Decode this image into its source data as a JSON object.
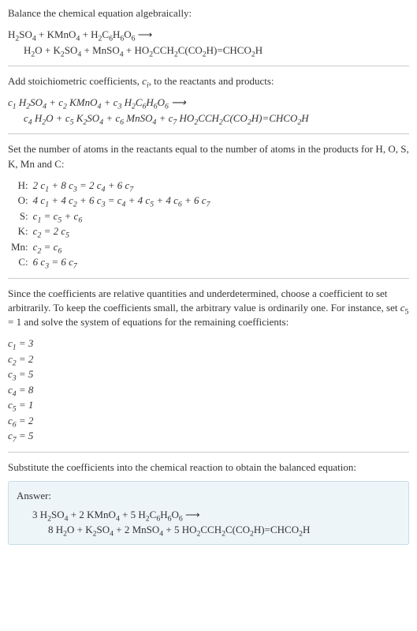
{
  "intro": "Balance the chemical equation algebraically:",
  "eq1_line1": "H₂SO₄ + KMnO₄ + H₂C₆H₆O₆ ⟶",
  "eq1_line2": "H₂O + K₂SO₄ + MnSO₄ + HO₂CCH₂C(CO₂H)=CHCO₂H",
  "stoich_intro": "Add stoichiometric coefficients, cᵢ, to the reactants and products:",
  "eq2_line1": "c₁ H₂SO₄ + c₂ KMnO₄ + c₃ H₂C₆H₆O₆ ⟶",
  "eq2_line2": "c₄ H₂O + c₅ K₂SO₄ + c₆ MnSO₄ + c₇ HO₂CCH₂C(CO₂H)=CHCO₂H",
  "set_intro": "Set the number of atoms in the reactants equal to the number of atoms in the products for H, O, S, K, Mn and C:",
  "atoms": [
    {
      "el": "H:",
      "eq": "2 c₁ + 8 c₃ = 2 c₄ + 6 c₇"
    },
    {
      "el": "O:",
      "eq": "4 c₁ + 4 c₂ + 6 c₃ = c₄ + 4 c₅ + 4 c₆ + 6 c₇"
    },
    {
      "el": "S:",
      "eq": "c₁ = c₅ + c₆"
    },
    {
      "el": "K:",
      "eq": "c₂ = 2 c₅"
    },
    {
      "el": "Mn:",
      "eq": "c₂ = c₆"
    },
    {
      "el": "C:",
      "eq": "6 c₃ = 6 c₇"
    }
  ],
  "solve_intro": "Since the coefficients are relative quantities and underdetermined, choose a coefficient to set arbitrarily. To keep the coefficients small, the arbitrary value is ordinarily one. For instance, set c₅ = 1 and solve the system of equations for the remaining coefficients:",
  "coeffs": [
    "c₁ = 3",
    "c₂ = 2",
    "c₃ = 5",
    "c₄ = 8",
    "c₅ = 1",
    "c₆ = 2",
    "c₇ = 5"
  ],
  "subst_intro": "Substitute the coefficients into the chemical reaction to obtain the balanced equation:",
  "answer_label": "Answer:",
  "answer_line1": "3 H₂SO₄ + 2 KMnO₄ + 5 H₂C₆H₆O₆ ⟶",
  "answer_line2": "8 H₂O + K₂SO₄ + 2 MnSO₄ + 5 HO₂CCH₂C(CO₂H)=CHCO₂H"
}
